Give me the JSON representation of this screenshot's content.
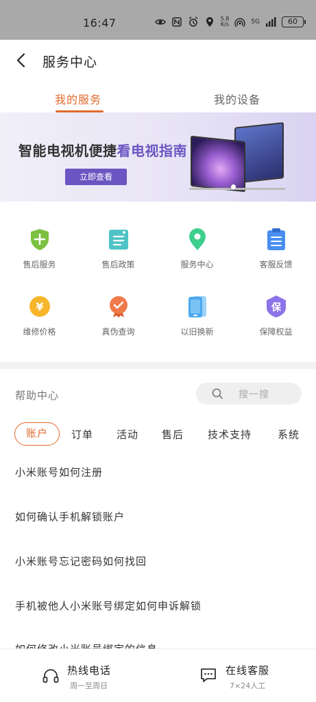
{
  "statusbar": {
    "time": "16:47",
    "speed_top": "5.8",
    "speed_bottom": "K/s",
    "network": "5G",
    "battery": "60"
  },
  "header": {
    "title": "服务中心"
  },
  "tabs": [
    {
      "label": "我的服务"
    },
    {
      "label": "我的设备"
    }
  ],
  "banner": {
    "title_part1": "智能电视机便捷",
    "title_part2": "看电视指南",
    "button": "立即查看"
  },
  "services": [
    {
      "label": "售后服务",
      "icon": "shield-plus-icon",
      "color": "#7cc142"
    },
    {
      "label": "售后政策",
      "icon": "document-icon",
      "color": "#4fc3c6"
    },
    {
      "label": "服务中心",
      "icon": "location-pin-icon",
      "color": "#3dcf8e"
    },
    {
      "label": "客服反馈",
      "icon": "clipboard-icon",
      "color": "#4a8ef0"
    },
    {
      "label": "维修价格",
      "icon": "yuan-coin-icon",
      "color": "#f6b52a"
    },
    {
      "label": "真伪查询",
      "icon": "certified-badge-icon",
      "color": "#f07a4a"
    },
    {
      "label": "以旧换新",
      "icon": "tablet-icon",
      "color": "#4aa8ee"
    },
    {
      "label": "保障权益",
      "icon": "guarantee-badge-icon",
      "color": "#8c73e8"
    }
  ],
  "help": {
    "title": "帮助中心",
    "search_placeholder": "搜一搜",
    "categories": [
      "账户",
      "订单",
      "活动",
      "售后",
      "技术支持",
      "系统"
    ],
    "questions": [
      "小米账号如何注册",
      "如何确认手机解锁账户",
      "小米账号忘记密码如何找回",
      "手机被他人小米账号绑定如何申诉解锁",
      "如何修改小米账号绑定的信息"
    ]
  },
  "bottom": {
    "hotline": "热线电话",
    "hotline_sub": "周一至周日",
    "online": "在线客服",
    "online_sub": "7×24人工"
  },
  "colors": {
    "accent": "#e06a2c",
    "banner_accent": "#6a56c2"
  }
}
